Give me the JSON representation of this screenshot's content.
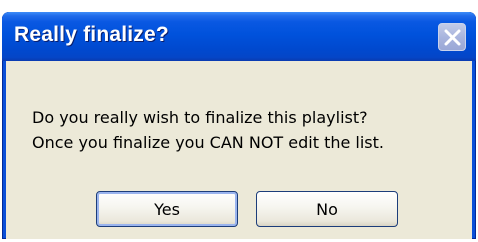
{
  "dialog": {
    "title": "Really finalize?",
    "message_line1": "Do you really wish to finalize this playlist?",
    "message_line2": "Once you finalize you CAN NOT edit the list.",
    "buttons": {
      "yes": "Yes",
      "no": "No"
    },
    "close_icon": "close-icon",
    "colors": {
      "title_bar": "#0052dc",
      "body": "#ece9d8",
      "title_text": "#ffffff"
    }
  }
}
